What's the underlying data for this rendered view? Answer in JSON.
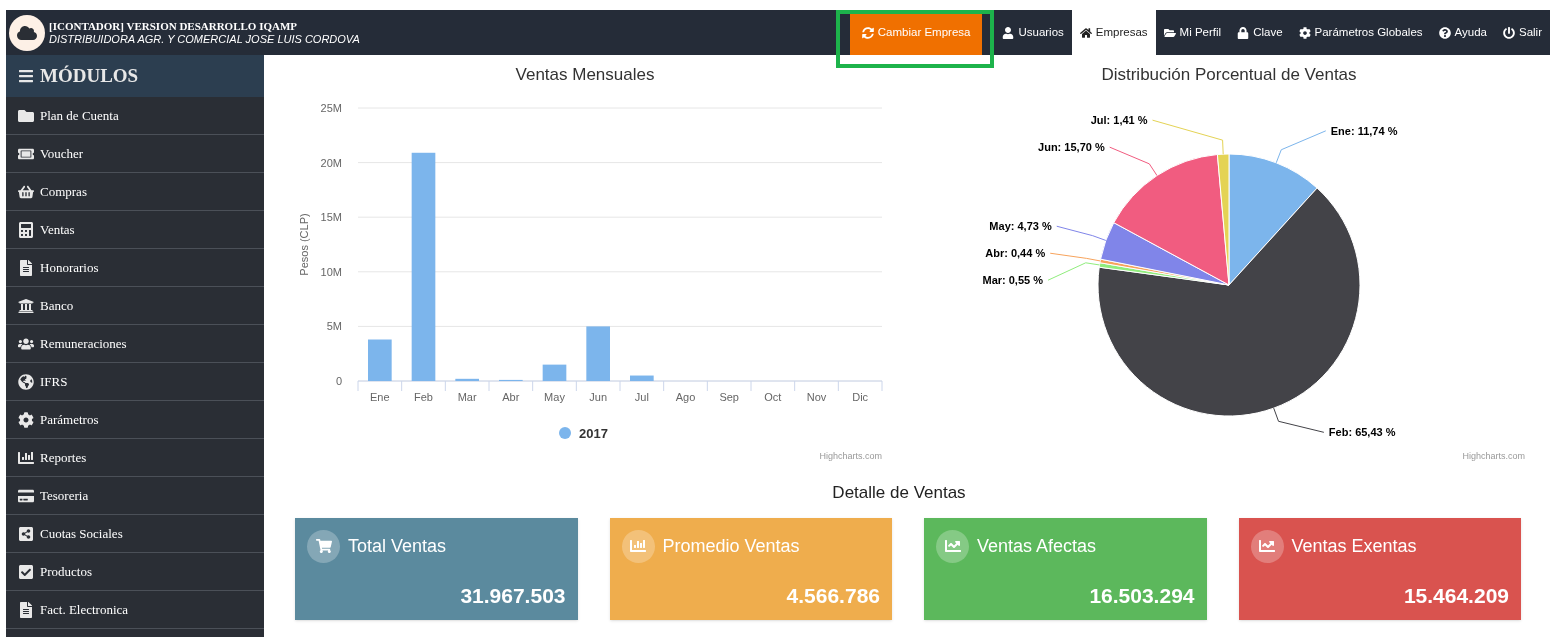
{
  "header": {
    "title": "[ICONTADOR] VERSION DESARROLLO IQAMP",
    "subtitle": "DISTRIBUIDORA AGR. Y COMERCIAL JOSE LUIS CORDOVA"
  },
  "nav": [
    {
      "label": "Cambiar Empresa",
      "kind": "action",
      "selected": false
    },
    {
      "label": "Usuarios",
      "kind": "link",
      "selected": false
    },
    {
      "label": "Empresas",
      "kind": "link",
      "selected": true
    },
    {
      "label": "Mi Perfil",
      "kind": "link",
      "selected": false
    },
    {
      "label": "Clave",
      "kind": "link",
      "selected": false
    },
    {
      "label": "Parámetros Globales",
      "kind": "link",
      "selected": false
    },
    {
      "label": "Ayuda",
      "kind": "link",
      "selected": false
    },
    {
      "label": "Salir",
      "kind": "link",
      "selected": false
    }
  ],
  "sidebar": {
    "title": "MÓDULOS",
    "items": [
      {
        "label": "Plan de Cuenta"
      },
      {
        "label": "Voucher"
      },
      {
        "label": "Compras"
      },
      {
        "label": "Ventas"
      },
      {
        "label": "Honorarios"
      },
      {
        "label": "Banco"
      },
      {
        "label": "Remuneraciones"
      },
      {
        "label": "IFRS"
      },
      {
        "label": "Parámetros"
      },
      {
        "label": "Reportes"
      },
      {
        "label": "Tesoreria"
      },
      {
        "label": "Cuotas Sociales"
      },
      {
        "label": "Productos"
      },
      {
        "label": "Fact. Electronica"
      }
    ]
  },
  "monthly_chart": {
    "credits": "Highcharts.com",
    "chart_data": {
      "type": "bar",
      "title": "Ventas Mensuales",
      "ylabel": "Pesos (CLP)",
      "categories": [
        "Ene",
        "Feb",
        "Mar",
        "Abr",
        "May",
        "Jun",
        "Jul",
        "Ago",
        "Sep",
        "Oct",
        "Nov",
        "Dic"
      ],
      "series": [
        {
          "name": "2017",
          "color": "#7cb5ec",
          "values": [
            3.8,
            20.9,
            0.2,
            0.1,
            1.5,
            5.0,
            0.5,
            0,
            0,
            0,
            0,
            0
          ]
        }
      ],
      "ylim": [
        0,
        25
      ],
      "grid": true,
      "yticks": [
        {
          "value": 0,
          "label": "0"
        },
        {
          "value": 5,
          "label": "5M"
        },
        {
          "value": 10,
          "label": "10M"
        },
        {
          "value": 15,
          "label": "15M"
        },
        {
          "value": 20,
          "label": "20M"
        },
        {
          "value": 25,
          "label": "25M"
        }
      ]
    }
  },
  "distribution_chart": {
    "credits": "Highcharts.com",
    "chart_data": {
      "type": "pie",
      "title": "Distribución Porcentual de Ventas",
      "series": [
        {
          "values": [
            11.74,
            65.43,
            0.55,
            0.44,
            4.73,
            15.7,
            1.41
          ]
        }
      ],
      "colors": [
        "#7cb5ec",
        "#434348",
        "#90ed7d",
        "#f7a35c",
        "#8085e9",
        "#f15c80",
        "#e4d354"
      ],
      "value_labels": [
        "Ene: 11,74 %",
        "Feb: 65,43 %",
        "Mar: 0,55 %",
        "Abr: 0,44 %",
        "May: 4,73 %",
        "Jun: 15,70 %",
        "Jul: 1,41 %"
      ]
    }
  },
  "details": {
    "title": "Detalle de Ventas",
    "cards": [
      {
        "label": "Total Ventas",
        "value": "31.967.503",
        "color": "#5b8a9e"
      },
      {
        "label": "Promedio Ventas",
        "value": "4.566.786",
        "color": "#efad4d"
      },
      {
        "label": "Ventas Afectas",
        "value": "16.503.294",
        "color": "#5cb85c"
      },
      {
        "label": "Ventas Exentas",
        "value": "15.464.209",
        "color": "#d9534f"
      }
    ]
  }
}
